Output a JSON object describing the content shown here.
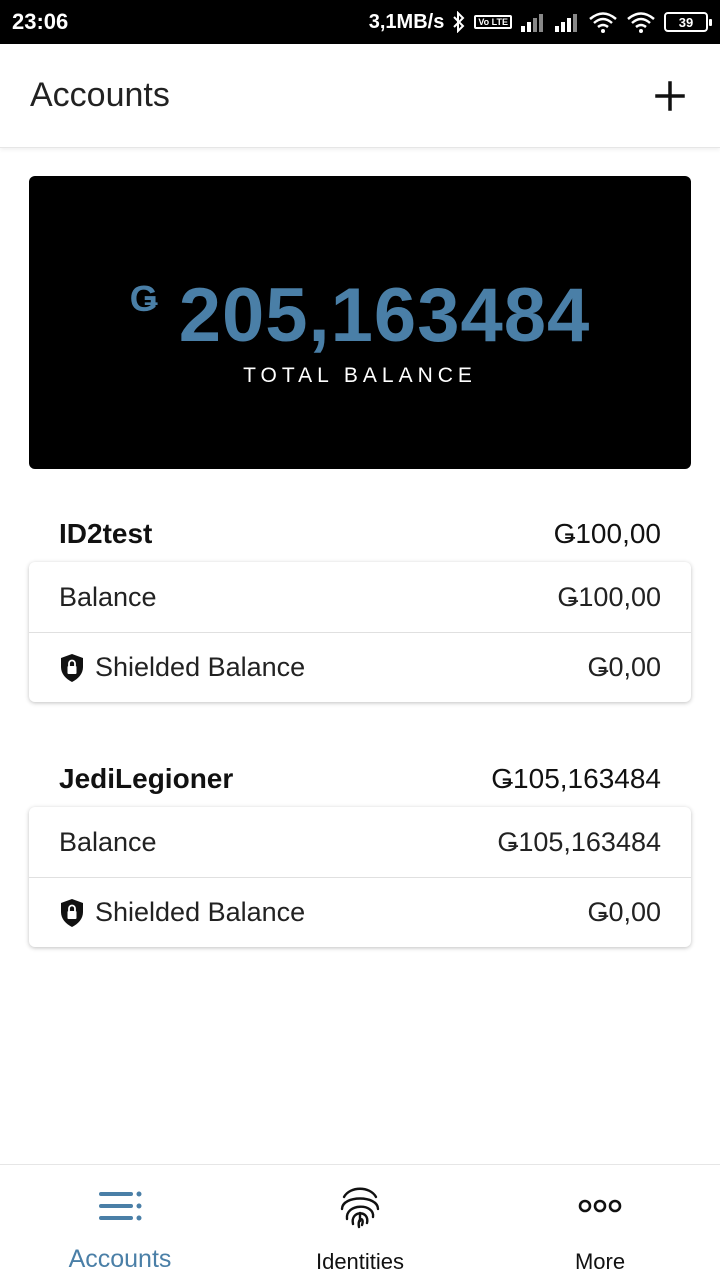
{
  "status_bar": {
    "time": "23:06",
    "net_speed": "3,1MB/s",
    "volte": "Vo LTE",
    "battery": "39"
  },
  "appbar": {
    "title": "Accounts",
    "add_icon": "plus-icon"
  },
  "total": {
    "currency": "Ǥ",
    "amount": "205,163484",
    "label": "TOTAL BALANCE",
    "accent": "#4a7fa7"
  },
  "accounts": [
    {
      "name": "ID2test",
      "total": "Ǥ100,00",
      "balance_label": "Balance",
      "balance": "Ǥ100,00",
      "shielded_label": "Shielded Balance",
      "shielded": "Ǥ0,00"
    },
    {
      "name": "JediLegioner",
      "total": "Ǥ105,163484",
      "balance_label": "Balance",
      "balance": "Ǥ105,163484",
      "shielded_label": "Shielded Balance",
      "shielded": "Ǥ0,00"
    }
  ],
  "bottom_nav": {
    "items": [
      {
        "label": "Accounts",
        "icon": "accounts-list-icon",
        "active": true
      },
      {
        "label": "Identities",
        "icon": "fingerprint-icon",
        "active": false
      },
      {
        "label": "More",
        "icon": "more-dots-icon",
        "active": false
      }
    ]
  }
}
